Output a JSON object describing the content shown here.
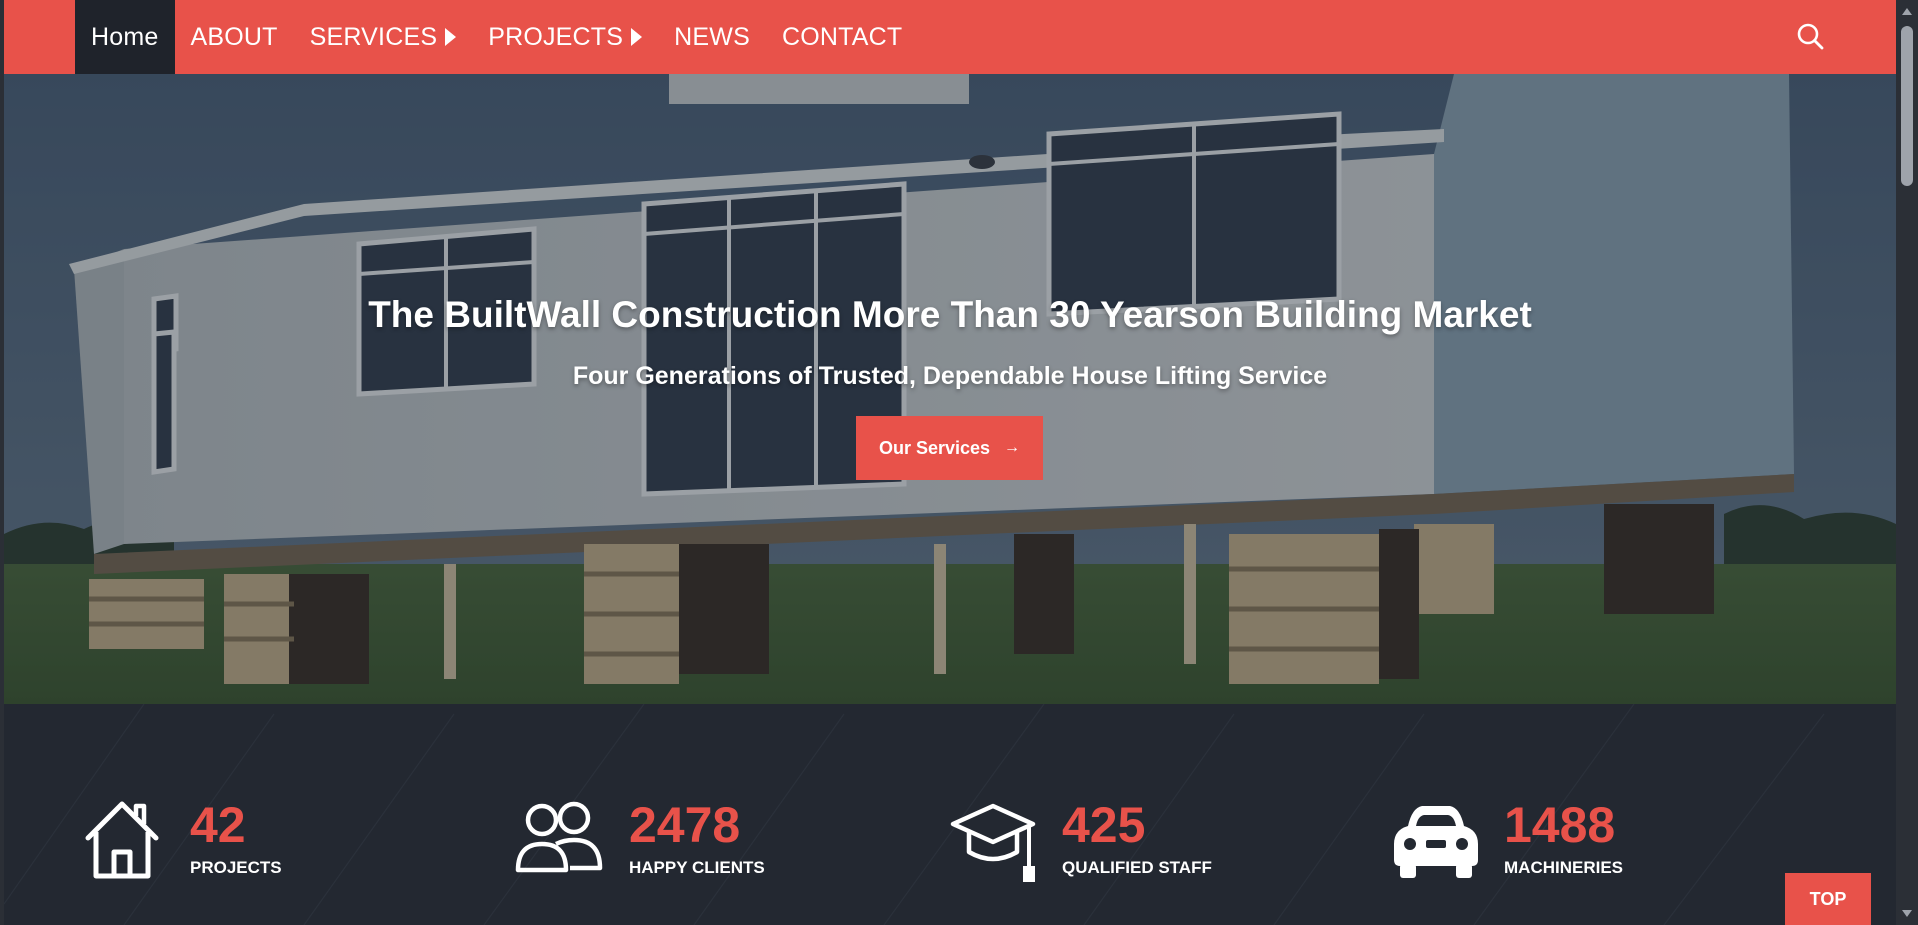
{
  "nav": {
    "items": [
      {
        "label": "Home",
        "active": true,
        "has_submenu": false
      },
      {
        "label": "ABOUT",
        "active": false,
        "has_submenu": false
      },
      {
        "label": "SERVICES",
        "active": false,
        "has_submenu": true
      },
      {
        "label": "PROJECTS",
        "active": false,
        "has_submenu": true
      },
      {
        "label": "NEWS",
        "active": false,
        "has_submenu": false
      },
      {
        "label": "CONTACT",
        "active": false,
        "has_submenu": false
      }
    ],
    "search_icon": "search-icon"
  },
  "hero": {
    "title": "The BuiltWall Construction More Than 30 Yearson Building Market",
    "subtitle": "Four Generations of Trusted, Dependable House Lifting Service",
    "button_label": "Our Services",
    "button_icon": "arrow-right-icon"
  },
  "stats": [
    {
      "icon": "house-icon",
      "number": "42",
      "label": "PROJECTS"
    },
    {
      "icon": "users-icon",
      "number": "2478",
      "label": "HAPPY CLIENTS"
    },
    {
      "icon": "graduation-cap-icon",
      "number": "425",
      "label": "QUALIFIED STAFF"
    },
    {
      "icon": "car-icon",
      "number": "1488",
      "label": "MACHINERIES"
    }
  ],
  "top_button": {
    "label": "TOP"
  },
  "colors": {
    "accent": "#e8524a",
    "dark": "#232831",
    "nav_active": "#1f232b",
    "text_light": "#ffffff"
  }
}
